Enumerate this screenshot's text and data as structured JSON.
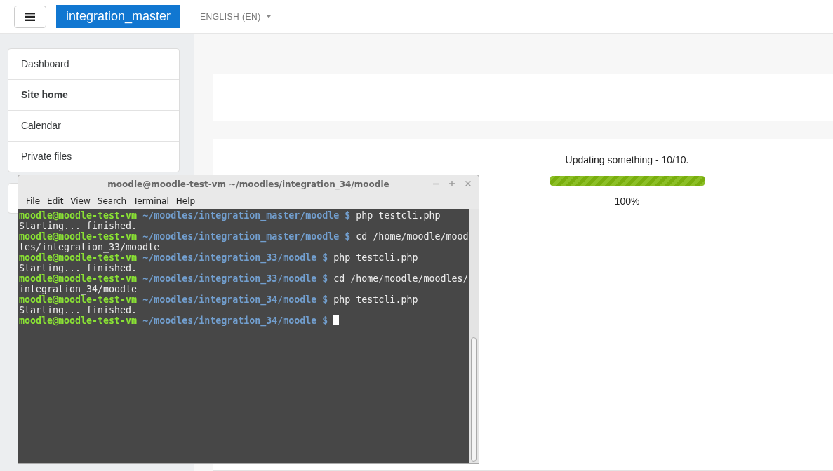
{
  "navbar": {
    "site_name": "integration_master",
    "language": "ENGLISH (EN)"
  },
  "sidebar": {
    "items": [
      {
        "label": "Dashboard",
        "selected": false
      },
      {
        "label": "Site home",
        "selected": true
      },
      {
        "label": "Calendar",
        "selected": false
      },
      {
        "label": "Private files",
        "selected": false
      }
    ]
  },
  "progress": {
    "message": "Updating something - 10/10.",
    "level": 1,
    "percent": "100%"
  },
  "terminal": {
    "title": "moodle@moodle-test-vm ~/moodles/integration_34/moodle",
    "menu": [
      "File",
      "Edit",
      "View",
      "Search",
      "Terminal",
      "Help"
    ],
    "lines": [
      {
        "segments": [
          {
            "kind": "user",
            "text": "moodle@moodle-test-vm"
          },
          {
            "kind": "path",
            "text": " ~/moodles/integration_master/moodle $"
          },
          {
            "kind": "plain",
            "text": " php testcli.php"
          }
        ]
      },
      {
        "segments": [
          {
            "kind": "plain",
            "text": "Starting... finished."
          }
        ]
      },
      {
        "segments": [
          {
            "kind": "user",
            "text": "moodle@moodle-test-vm"
          },
          {
            "kind": "path",
            "text": " ~/moodles/integration_master/moodle $"
          },
          {
            "kind": "plain",
            "text": " cd /home/moodle/mood"
          }
        ]
      },
      {
        "segments": [
          {
            "kind": "plain",
            "text": "les/integration_33/moodle"
          }
        ]
      },
      {
        "segments": [
          {
            "kind": "user",
            "text": "moodle@moodle-test-vm"
          },
          {
            "kind": "path",
            "text": " ~/moodles/integration_33/moodle $"
          },
          {
            "kind": "plain",
            "text": " php testcli.php"
          }
        ]
      },
      {
        "segments": [
          {
            "kind": "plain",
            "text": "Starting... finished."
          }
        ]
      },
      {
        "segments": [
          {
            "kind": "user",
            "text": "moodle@moodle-test-vm"
          },
          {
            "kind": "path",
            "text": " ~/moodles/integration_33/moodle $"
          },
          {
            "kind": "plain",
            "text": " cd /home/moodle/moodles/"
          }
        ]
      },
      {
        "segments": [
          {
            "kind": "plain",
            "text": "integration_34/moodle"
          }
        ]
      },
      {
        "segments": [
          {
            "kind": "user",
            "text": "moodle@moodle-test-vm"
          },
          {
            "kind": "path",
            "text": " ~/moodles/integration_34/moodle $"
          },
          {
            "kind": "plain",
            "text": " php testcli.php"
          }
        ]
      },
      {
        "segments": [
          {
            "kind": "plain",
            "text": "Starting... finished."
          }
        ]
      },
      {
        "segments": [
          {
            "kind": "user",
            "text": "moodle@moodle-test-vm"
          },
          {
            "kind": "path",
            "text": " ~/moodles/integration_34/moodle $"
          }
        ],
        "cursor": true
      }
    ]
  }
}
